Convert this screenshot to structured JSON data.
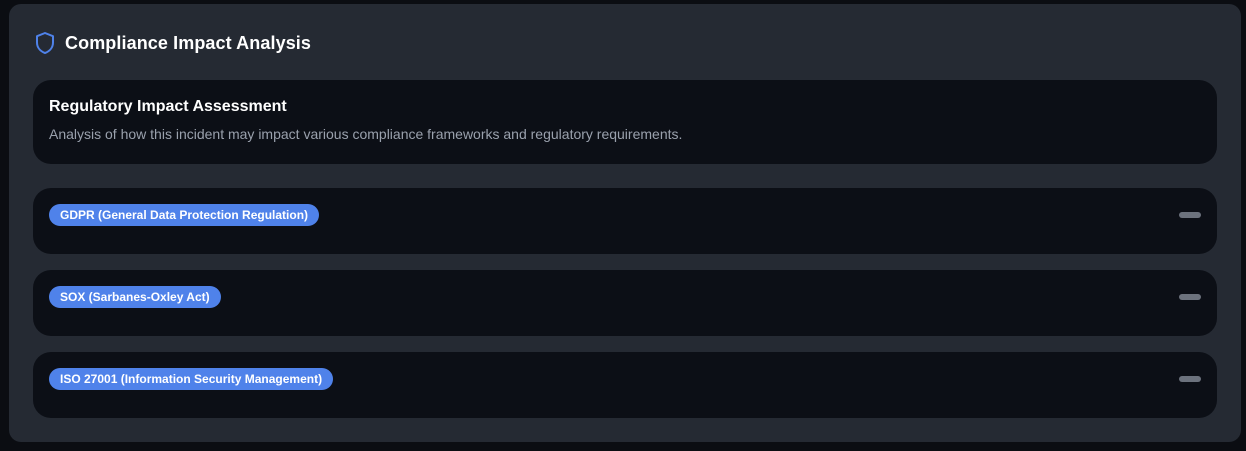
{
  "header": {
    "title": "Compliance Impact Analysis",
    "icon": "shield-icon",
    "accent_color": "#4f82ea"
  },
  "assessment": {
    "title": "Regulatory Impact Assessment",
    "description": "Analysis of how this incident may impact various compliance frameworks and regulatory requirements."
  },
  "frameworks": [
    {
      "label": "GDPR (General Data Protection Regulation)",
      "toggle_icon": "minus-icon"
    },
    {
      "label": "SOX (Sarbanes-Oxley Act)",
      "toggle_icon": "minus-icon"
    },
    {
      "label": "ISO 27001 (Information Security Management)",
      "toggle_icon": "minus-icon"
    }
  ],
  "colors": {
    "page_background": "#0b0d12",
    "panel_background": "#252a33",
    "card_background": "#0c0f16",
    "badge_background": "#4f82ea",
    "muted_text": "#9aa1ad"
  }
}
